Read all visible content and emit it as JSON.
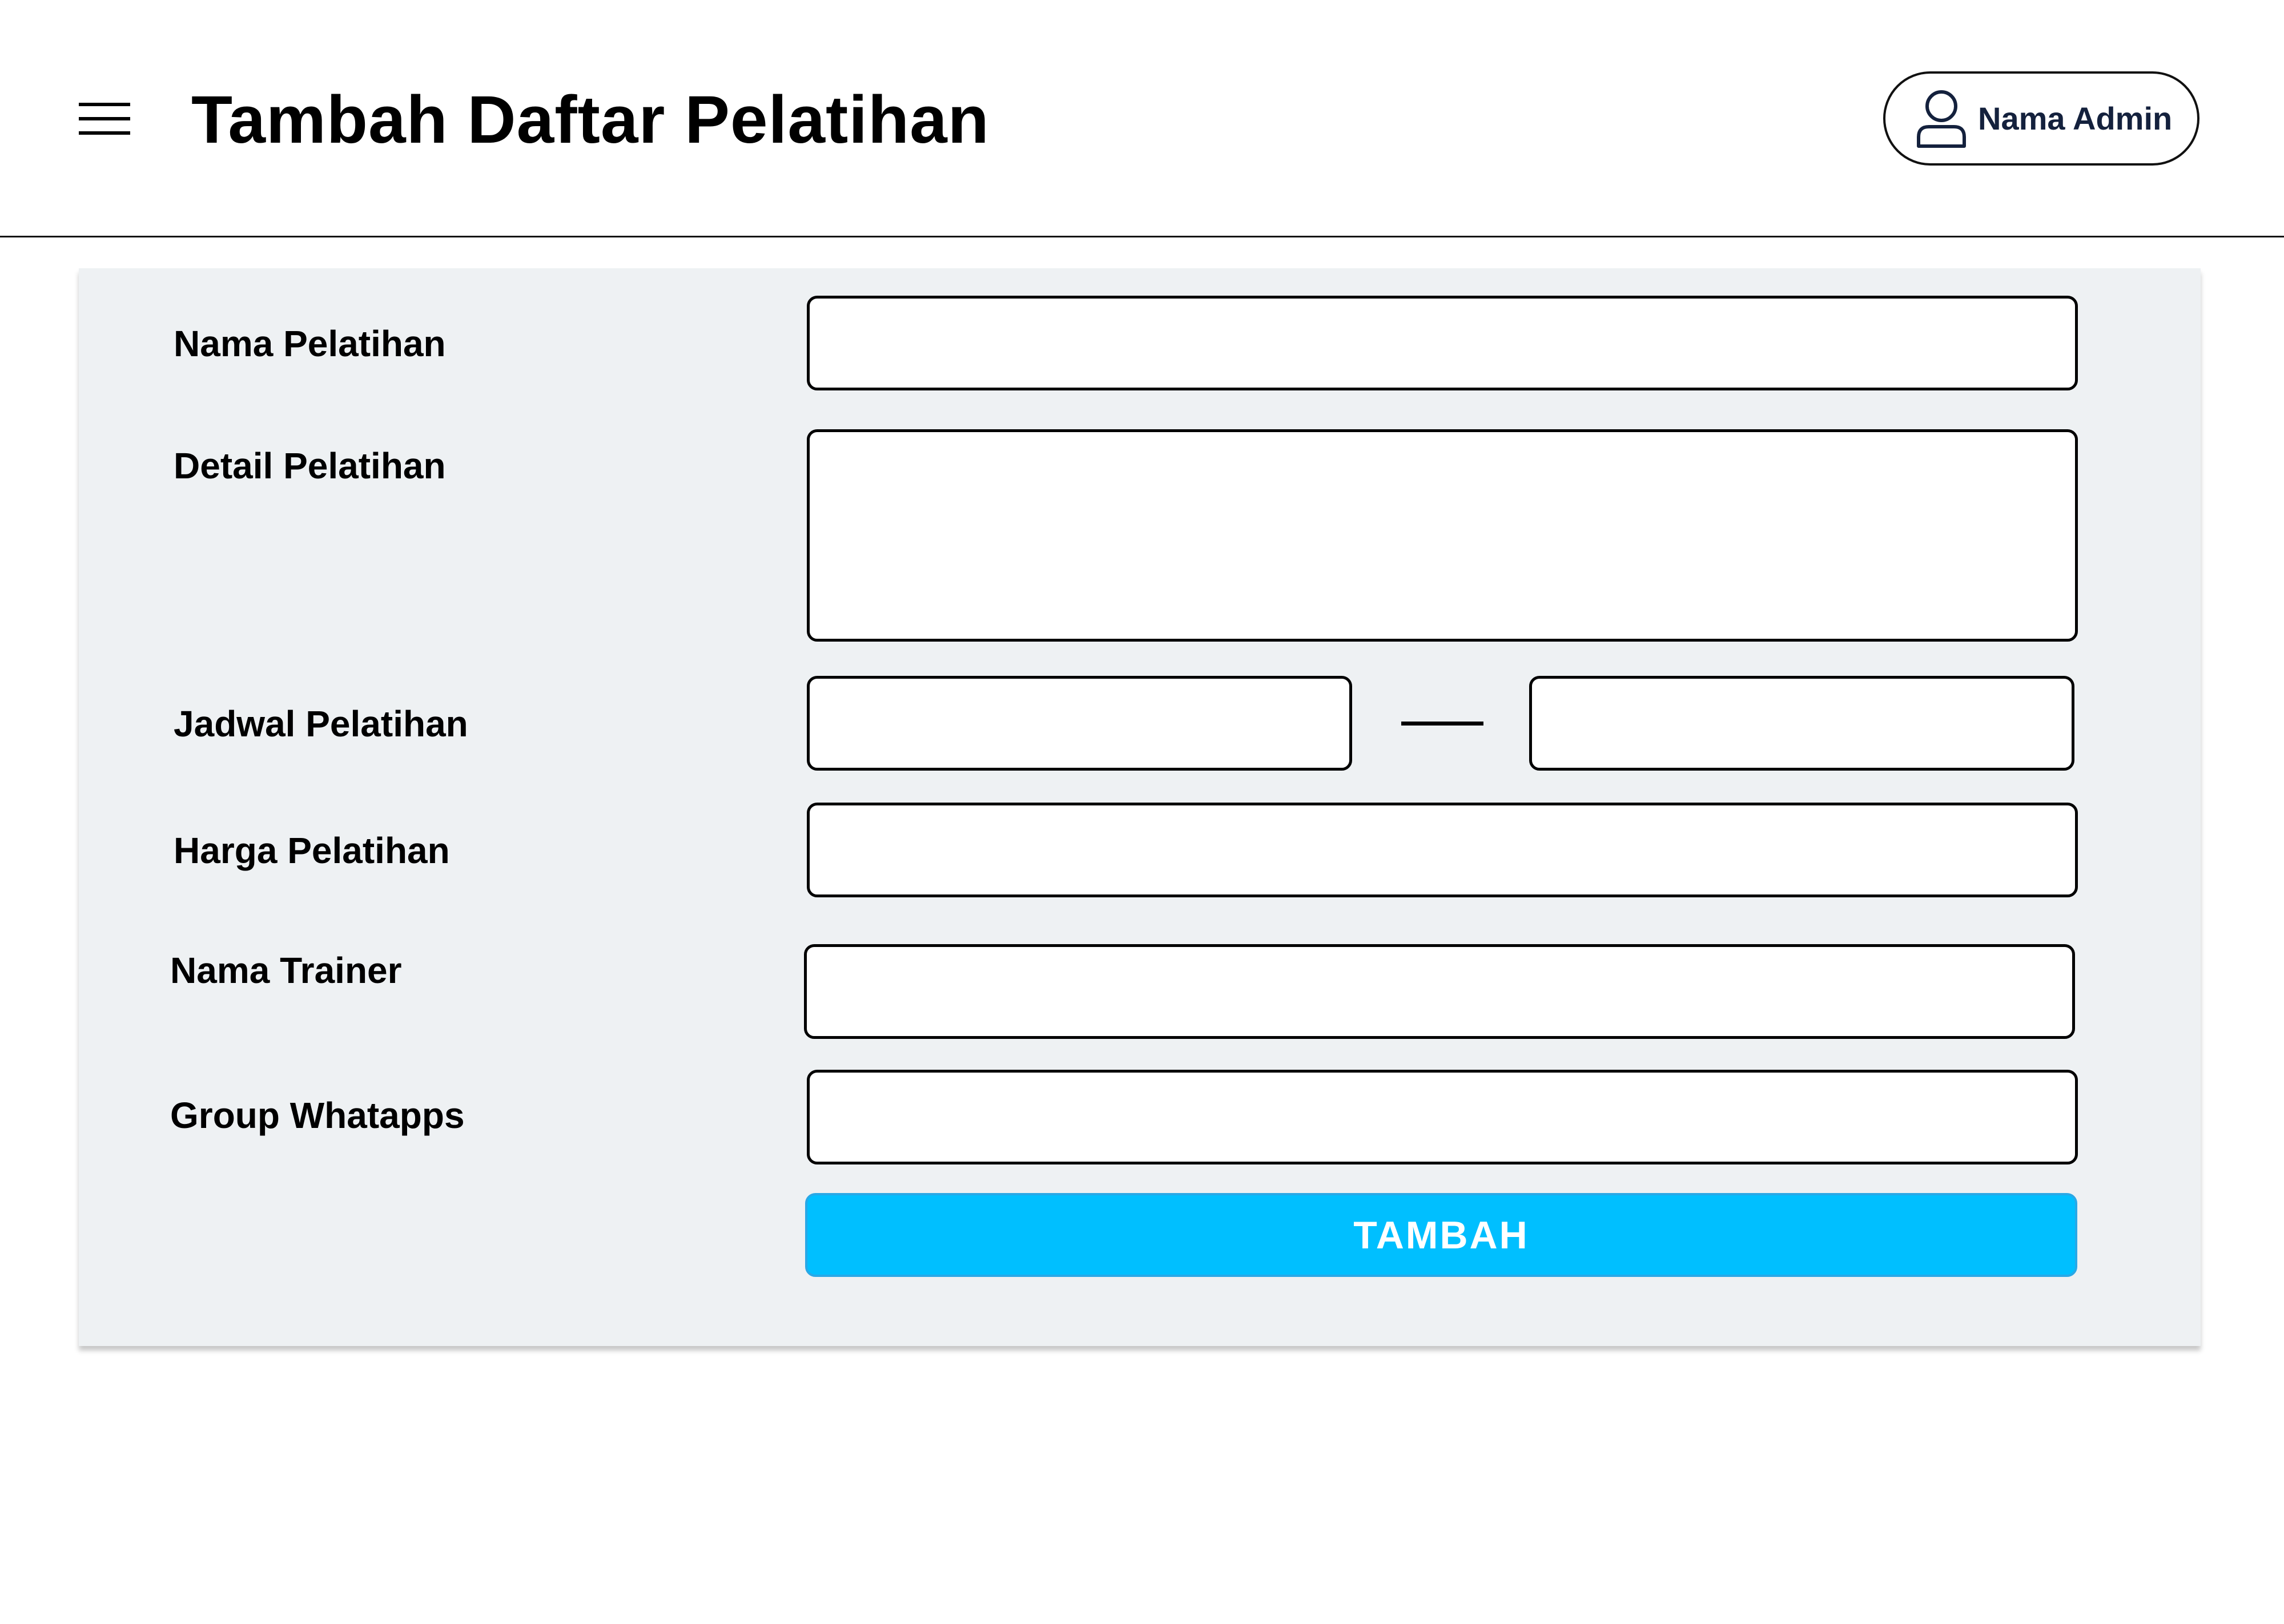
{
  "header": {
    "title": "Tambah Daftar Pelatihan",
    "menu_icon": "hamburger-menu-icon",
    "admin_icon": "user-icon",
    "admin_name": "Nama Admin"
  },
  "form": {
    "nama_pelatihan": {
      "label": "Nama Pelatihan",
      "value": ""
    },
    "detail_pelatihan": {
      "label": "Detail Pelatihan",
      "value": ""
    },
    "jadwal_pelatihan": {
      "label": "Jadwal Pelatihan",
      "start_value": "",
      "end_value": ""
    },
    "harga_pelatihan": {
      "label": "Harga Pelatihan",
      "value": ""
    },
    "nama_trainer": {
      "label": "Nama Trainer",
      "value": ""
    },
    "group_whatsapp": {
      "label": "Group Whatapps",
      "value": ""
    },
    "submit_label": "TAMBAH"
  },
  "colors": {
    "button": "#00bfff",
    "panel": "#eef1f3",
    "admin_text": "#14213d"
  }
}
